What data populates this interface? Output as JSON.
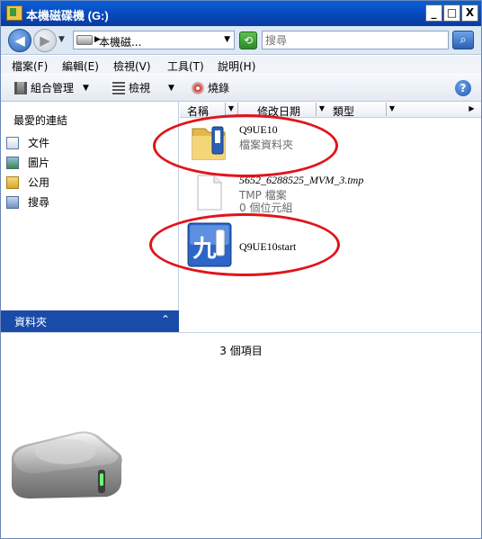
{
  "window": {
    "title": "本機磁碟機 (G:)",
    "minimize": "_",
    "maximize": "□",
    "close": "X"
  },
  "address": {
    "path": "本機磁...",
    "search_placeholder": "搜尋"
  },
  "menu": [
    "檔案(F)",
    "編輯(E)",
    "檢視(V)",
    "工具(T)",
    "說明(H)"
  ],
  "toolbar": {
    "organize": "組合管理",
    "views": "檢視",
    "burn": "燒錄"
  },
  "favorites": {
    "heading": "最愛的連結",
    "items": [
      "文件",
      "圖片",
      "公用",
      "搜尋"
    ]
  },
  "folders_label": "資料夾",
  "columns": [
    "名稱",
    "修改日期",
    "類型"
  ],
  "files": [
    {
      "name": "Q9UE10",
      "sub": "檔案資料夾",
      "icon": "folder-usb-icon"
    },
    {
      "name": "5652_6288525_MVM_3.tmp",
      "sub": "TMP 檔案",
      "sub2": "0 個位元組",
      "icon": "tmp-file-icon"
    },
    {
      "name": "Q9UE10start",
      "icon": "app-icon"
    }
  ],
  "status": {
    "item_count": "3 個項目"
  },
  "colors": {
    "title_bar": "#0846b8",
    "folders_bar": "#1a4ba8",
    "annotation_oval": "#e0141b"
  }
}
